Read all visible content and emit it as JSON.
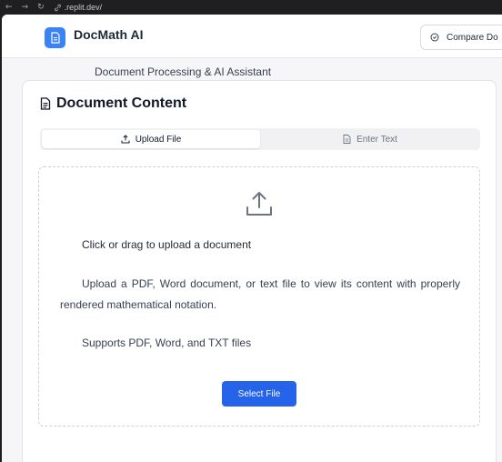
{
  "browser": {
    "url": ".replit.dev/"
  },
  "header": {
    "app_title": "DocMath AI",
    "compare_label": "Compare Do"
  },
  "subtitle": "Document Processing & AI Assistant",
  "card": {
    "title": "Document Content",
    "tabs": [
      {
        "label": "Upload File",
        "active": true
      },
      {
        "label": "Enter Text",
        "active": false
      }
    ],
    "dropzone": {
      "title": "Click or drag to upload a document",
      "description": "Upload a PDF, Word document, or text file to view its content with properly rendered mathematical notation.",
      "supports": "Supports PDF, Word, and TXT files",
      "button_label": "Select File"
    }
  },
  "colors": {
    "accent": "#2563eb",
    "logo": "#3b82f6"
  }
}
